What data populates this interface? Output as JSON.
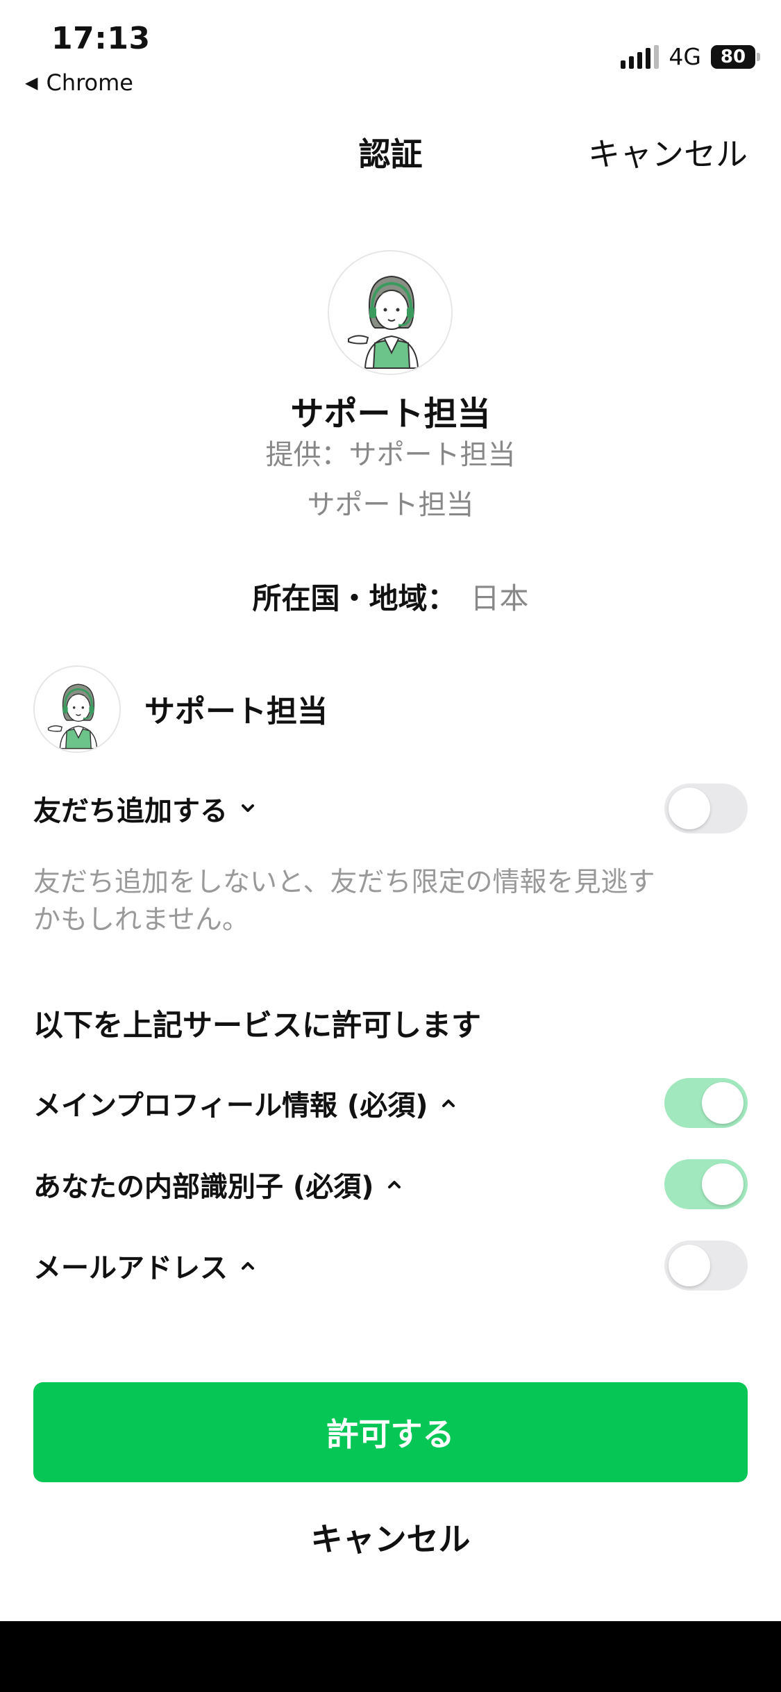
{
  "status_bar": {
    "time": "17:13",
    "back_app": "Chrome",
    "network": "4G",
    "battery": "80"
  },
  "header": {
    "title": "認証",
    "cancel": "キャンセル"
  },
  "channel": {
    "name": "サポート担当",
    "provider": "提供：サポート担当",
    "description": "サポート担当",
    "region_label": "所在国・地域：",
    "region_value": "日本",
    "avatar_icon": "support-agent-avatar-icon"
  },
  "add_friend": {
    "account_name": "サポート担当",
    "label": "友だち追加する",
    "enabled": false,
    "note": "友だち追加をしないと、友だち限定の情報を見逃すかもしれません。"
  },
  "permissions": {
    "heading": "以下を上記サービスに許可します",
    "items": [
      {
        "label": "メインプロフィール情報 (必須)",
        "enabled": true
      },
      {
        "label": "あなたの内部識別子 (必須)",
        "enabled": true
      },
      {
        "label": "メールアドレス",
        "enabled": false
      }
    ]
  },
  "actions": {
    "allow": "許可する",
    "cancel": "キャンセル"
  },
  "colors": {
    "accent_green": "#06c755",
    "toggle_on": "#a2e8be",
    "toggle_off": "#e9e9eb",
    "muted_text": "#888888"
  }
}
